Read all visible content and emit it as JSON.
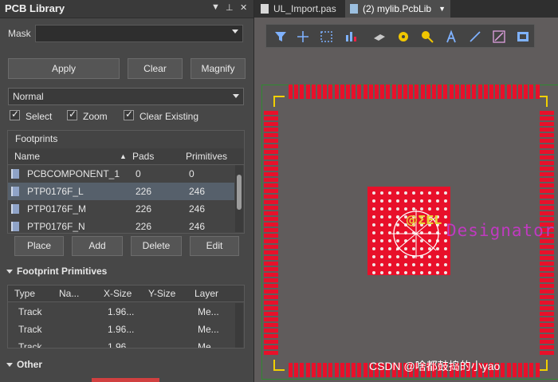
{
  "panel": {
    "title": "PCB Library",
    "mask_label": "Mask",
    "mask_value": "",
    "buttons": {
      "apply": "Apply",
      "clear": "Clear",
      "magnify": "Magnify"
    },
    "mode_select": "Normal",
    "checks": [
      {
        "label": "Select",
        "checked": true
      },
      {
        "label": "Zoom",
        "checked": true
      },
      {
        "label": "Clear Existing",
        "checked": true
      }
    ]
  },
  "footprints": {
    "title": "Footprints",
    "headers": {
      "name": "Name",
      "pads": "Pads",
      "primitives": "Primitives"
    },
    "rows": [
      {
        "name": "PCBCOMPONENT_1",
        "pads": "0",
        "primitives": "0"
      },
      {
        "name": "PTP0176F_L",
        "pads": "226",
        "primitives": "246"
      },
      {
        "name": "PTP0176F_M",
        "pads": "226",
        "primitives": "246"
      },
      {
        "name": "PTP0176F_N",
        "pads": "226",
        "primitives": "246"
      }
    ],
    "selected_index": 1,
    "buttons": {
      "place": "Place",
      "add": "Add",
      "delete": "Delete",
      "edit": "Edit"
    }
  },
  "primitives": {
    "title": "Footprint Primitives",
    "headers": {
      "type": "Type",
      "name": "Na...",
      "xsize": "X-Size",
      "ysize": "Y-Size",
      "layer": "Layer"
    },
    "rows": [
      {
        "type": "Track",
        "name": "",
        "xsize": "1.96...",
        "ysize": "",
        "layer": "Me..."
      },
      {
        "type": "Track",
        "name": "",
        "xsize": "1.96...",
        "ysize": "",
        "layer": "Me..."
      },
      {
        "type": "Track",
        "name": "",
        "xsize": "1.96...",
        "ysize": "",
        "layer": "Me..."
      }
    ]
  },
  "other": {
    "title": "Other"
  },
  "tabs": [
    {
      "label": "UL_Import.pas",
      "active": false
    },
    {
      "label": "(2) mylib.PcbLib",
      "active": true
    }
  ],
  "canvas": {
    "designator_text": "Designator",
    "comment_text": "@ΣΕL"
  },
  "watermark": "CSDN @啥都鼓捣的小yao",
  "colors": {
    "pad": "#e8102a",
    "designator": "#c03ac0",
    "outline": "#2f8a2f"
  }
}
